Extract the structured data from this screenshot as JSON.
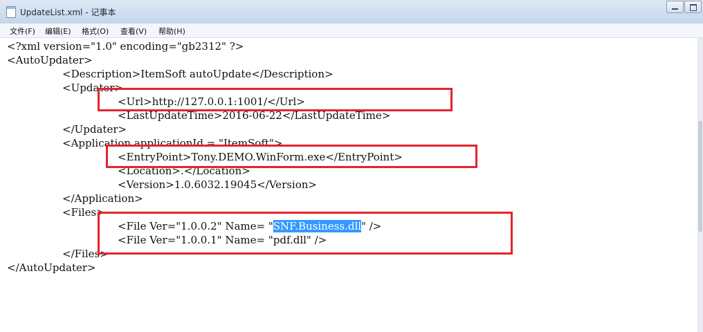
{
  "window": {
    "title": "UpdateList.xml - 记事本",
    "icon": "notepad-icon"
  },
  "menu": [
    {
      "label": "文件(F)"
    },
    {
      "label": "编辑(E)"
    },
    {
      "label": "格式(O)"
    },
    {
      "label": "查看(V)"
    },
    {
      "label": "帮助(H)"
    }
  ],
  "editor": {
    "lines": [
      "<?xml version=\"1.0\" encoding=\"gb2312\" ?>",
      "<AutoUpdater>",
      "<Description>ItemSoft autoUpdate</Description>",
      "<Updater>",
      "<Url>http://127.0.0.1:1001/</Url>",
      "<LastUpdateTime>2016-06-22</LastUpdateTime>",
      "</Updater>",
      "<Application applicationId = \"ItemSoft\">",
      "<EntryPoint>Tony.DEMO.WinForm.exe</EntryPoint>",
      "<Location>.</Location>",
      "<Version>1.0.6032.19045</Version>",
      "</Application>",
      "<Files>",
      "<File Ver=\"1.0.0.1\" Name= \"pdf.dll\" />",
      "</Files>",
      "</AutoUpdater>"
    ],
    "selected_line": {
      "before": "<File Ver=\"1.0.0.2\" Name= \"",
      "selected": "SNF.Business.dll",
      "after": "\" />"
    }
  },
  "annotation_color": "#e3242b",
  "selection_color": "#3399ff"
}
